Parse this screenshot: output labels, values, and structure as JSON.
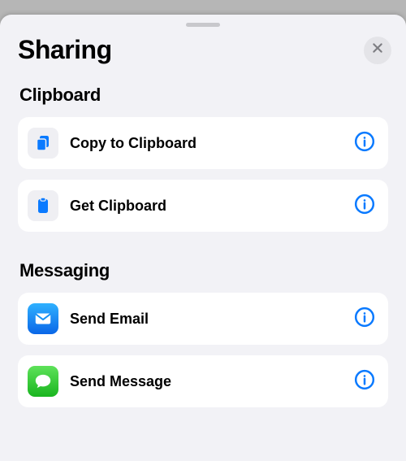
{
  "title": "Sharing",
  "accent": "#0a7aff",
  "sections": [
    {
      "title": "Clipboard",
      "items": [
        {
          "label": "Copy to Clipboard",
          "icon": "copy-to-clipboard-icon",
          "chip": "gray"
        },
        {
          "label": "Get Clipboard",
          "icon": "clipboard-icon",
          "chip": "gray"
        }
      ]
    },
    {
      "title": "Messaging",
      "items": [
        {
          "label": "Send Email",
          "icon": "mail-icon",
          "chip": "mail"
        },
        {
          "label": "Send Message",
          "icon": "message-icon",
          "chip": "msg"
        }
      ]
    }
  ]
}
